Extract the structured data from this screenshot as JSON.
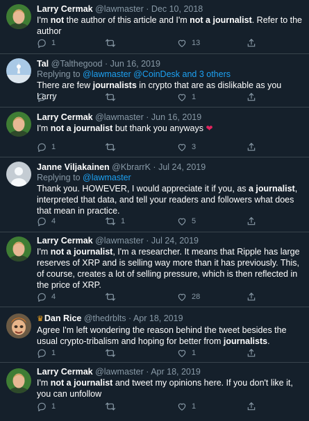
{
  "tweets": [
    {
      "name": "Larry Cermak",
      "handle": "@lawmaster",
      "dot": "·",
      "date": "Dec 10, 2018",
      "text": [
        "I'm ",
        "not",
        " the author of this article and I'm ",
        "not a journalist",
        ". Refer to the author"
      ],
      "replies": "1",
      "retweets": "",
      "likes": "13"
    },
    {
      "name": "Tal",
      "handle": "@Talthegood",
      "dot": "·",
      "date": "Jun 16, 2019",
      "replying_label": "Replying to",
      "replying_to": "@lawmaster @CoinDesk and 3 others",
      "text": [
        "There are few ",
        "journalists",
        " in crypto that are as dislikable as you Larry"
      ],
      "replies": "1",
      "retweets": "",
      "likes": "1"
    },
    {
      "name": "Larry Cermak",
      "handle": "@lawmaster",
      "dot": "·",
      "date": "Jun 16, 2019",
      "text": [
        "I'm ",
        "not a journalist",
        " but thank you anyways"
      ],
      "emoji": "❤",
      "replies": "1",
      "retweets": "",
      "likes": "3"
    },
    {
      "name": "Janne Viljakainen",
      "handle": "@KbrarrK",
      "dot": "·",
      "date": "Jul 24, 2019",
      "replying_label": "Replying to",
      "replying_to": "@lawmaster",
      "text": [
        "Thank you. HOWEVER, I would appreciate it if you, as ",
        "a journalist",
        ", interpreted that data,  and tell your readers and  followers what does that mean in practice."
      ],
      "replies": "4",
      "retweets": "1",
      "likes": "5"
    },
    {
      "name": "Larry Cermak",
      "handle": "@lawmaster",
      "dot": "·",
      "date": "Jul 24, 2019",
      "text": [
        "I'm ",
        "not a journalist",
        ", I'm a researcher. It means that Ripple has large reserves of XRP and is selling way more than it has previously. This, of course, creates a lot of selling pressure, which is then reflected in the price of XRP."
      ],
      "replies": "4",
      "retweets": "",
      "likes": "28"
    },
    {
      "name": "Dan Rice",
      "handle": "@thedrblts",
      "dot": "·",
      "date": "Apr 18, 2019",
      "crown": "♛",
      "text": [
        "Agree I'm left wondering the reason behind the tweet besides the usual crypto-tribalism and hoping for better from ",
        "journalists",
        "."
      ],
      "replies": "1",
      "retweets": "",
      "likes": "1"
    },
    {
      "name": "Larry Cermak",
      "handle": "@lawmaster",
      "dot": "·",
      "date": "Apr 18, 2019",
      "text": [
        "I'm ",
        "not a journalist",
        " and tweet my opinions here. If you don't like it, you can unfollow"
      ],
      "replies": "1",
      "retweets": "",
      "likes": "1"
    }
  ],
  "colors": {
    "background": "#15202b",
    "divider": "#38444d",
    "muted": "#8899a6",
    "link": "#1da1f2",
    "heart": "#e0245e"
  },
  "icons": [
    "reply-icon",
    "retweet-icon",
    "like-icon",
    "share-icon",
    "heart-emoji",
    "crown-emoji"
  ]
}
